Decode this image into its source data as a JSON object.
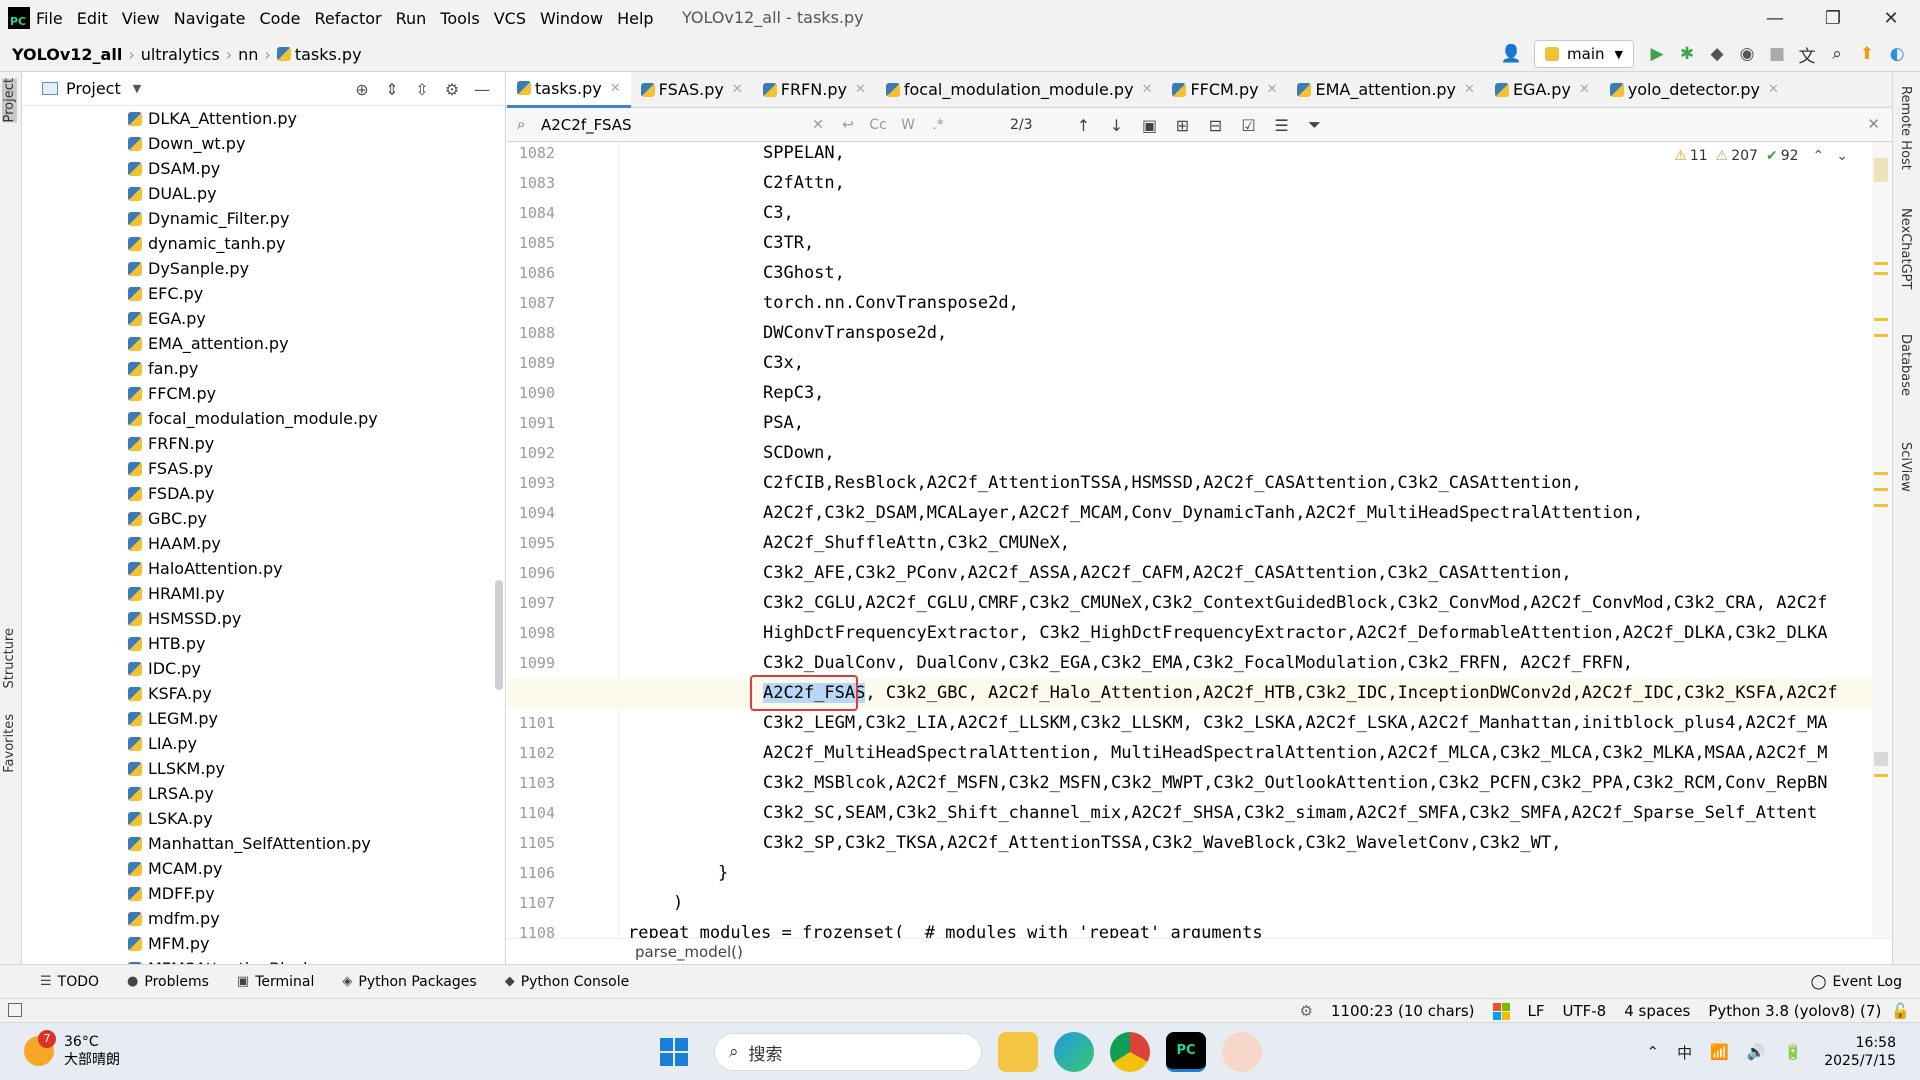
{
  "window": {
    "title": "YOLOv12_all - tasks.py",
    "menu": [
      "File",
      "Edit",
      "View",
      "Navigate",
      "Code",
      "Refactor",
      "Run",
      "Tools",
      "VCS",
      "Window",
      "Help"
    ],
    "controls": [
      "—",
      "❐",
      "✕"
    ]
  },
  "breadcrumb": [
    "YOLOv12_all",
    "ultralytics",
    "nn",
    "tasks.py"
  ],
  "nav": {
    "branch": "main"
  },
  "left_stripe": {
    "project": "Project",
    "structure": "Structure",
    "favorites": "Favorites"
  },
  "project_panel": {
    "title": "Project",
    "files": [
      "DLKA_Attention.py",
      "Down_wt.py",
      "DSAM.py",
      "DUAL.py",
      "Dynamic_Filter.py",
      "dynamic_tanh.py",
      "DySanple.py",
      "EFC.py",
      "EGA.py",
      "EMA_attention.py",
      "fan.py",
      "FFCM.py",
      "focal_modulation_module.py",
      "FRFN.py",
      "FSAS.py",
      "FSDA.py",
      "GBC.py",
      "HAAM.py",
      "HaloAttention.py",
      "HRAMI.py",
      "HSMSSD.py",
      "HTB.py",
      "IDC.py",
      "KSFA.py",
      "LEGM.py",
      "LIA.py",
      "LLSKM.py",
      "LRSA.py",
      "LSKA.py",
      "Manhattan_SelfAttention.py",
      "MCAM.py",
      "MDFF.py",
      "mdfm.py",
      "MFM.py",
      "MFMSAttentionBlock.py"
    ]
  },
  "editor_tabs": [
    {
      "label": "tasks.py",
      "active": true
    },
    {
      "label": "FSAS.py",
      "active": false
    },
    {
      "label": "FRFN.py",
      "active": false
    },
    {
      "label": "focal_modulation_module.py",
      "active": false
    },
    {
      "label": "FFCM.py",
      "active": false
    },
    {
      "label": "EMA_attention.py",
      "active": false
    },
    {
      "label": "EGA.py",
      "active": false
    },
    {
      "label": "yolo_detector.py",
      "active": false
    }
  ],
  "find": {
    "query": "A2C2f_FSAS",
    "count": "2/3",
    "opts": [
      "Cc",
      "W",
      ".*"
    ]
  },
  "inspections": {
    "warnings_a": "11",
    "warnings_b": "207",
    "ok": "92"
  },
  "code": [
    {
      "ln": "1082",
      "indent": 4,
      "text": "SPPELAN,"
    },
    {
      "ln": "1083",
      "indent": 4,
      "text": "C2fAttn,"
    },
    {
      "ln": "1084",
      "indent": 4,
      "text": "C3,"
    },
    {
      "ln": "1085",
      "indent": 4,
      "text": "C3TR,"
    },
    {
      "ln": "1086",
      "indent": 4,
      "text": "C3Ghost,"
    },
    {
      "ln": "1087",
      "indent": 4,
      "text": "torch.nn.ConvTranspose2d,"
    },
    {
      "ln": "1088",
      "indent": 4,
      "text": "DWConvTranspose2d,"
    },
    {
      "ln": "1089",
      "indent": 4,
      "text": "C3x,"
    },
    {
      "ln": "1090",
      "indent": 4,
      "text": "RepC3,"
    },
    {
      "ln": "1091",
      "indent": 4,
      "text": "PSA,"
    },
    {
      "ln": "1092",
      "indent": 4,
      "text": "SCDown,"
    },
    {
      "ln": "1093",
      "indent": 4,
      "text": "C2fCIB,ResBlock,A2C2f_AttentionTSSA,HSMSSD,A2C2f_CASAttention,C3k2_CASAttention,"
    },
    {
      "ln": "1094",
      "indent": 4,
      "text": "A2C2f,C3k2_DSAM,MCALayer,A2C2f_MCAM,Conv_DynamicTanh,A2C2f_MultiHeadSpectralAttention,"
    },
    {
      "ln": "1095",
      "indent": 4,
      "text": "A2C2f_ShuffleAttn,C3k2_CMUNeX,"
    },
    {
      "ln": "1096",
      "indent": 4,
      "text": "C3k2_AFE,C3k2_PConv,A2C2f_ASSA,A2C2f_CAFM,A2C2f_CASAttention,C3k2_CASAttention,"
    },
    {
      "ln": "1097",
      "indent": 4,
      "text": "C3k2_CGLU,A2C2f_CGLU,CMRF,C3k2_CMUNeX,C3k2_ContextGuidedBlock,C3k2_ConvMod,A2C2f_ConvMod,C3k2_CRA, A2C2f"
    },
    {
      "ln": "1098",
      "indent": 4,
      "text": "HighDctFrequencyExtractor, C3k2_HighDctFrequencyExtractor,A2C2f_DeformableAttention,A2C2f_DLKA,C3k2_DLKA"
    },
    {
      "ln": "1099",
      "indent": 4,
      "text": "C3k2_DualConv, DualConv,C3k2_EGA,C3k2_EMA,C3k2_FocalModulation,C3k2_FRFN, A2C2f_FRFN,"
    },
    {
      "ln": "1100",
      "indent": 4,
      "text": ", C3k2_GBC, A2C2f_Halo_Attention,A2C2f_HTB,C3k2_IDC,InceptionDWConv2d,A2C2f_IDC,C3k2_KSFA,A2C2f",
      "match": "A2C2f_FSAS",
      "current": true
    },
    {
      "ln": "1101",
      "indent": 4,
      "text": "C3k2_LEGM,C3k2_LIA,A2C2f_LLSKM,C3k2_LLSKM, C3k2_LSKA,A2C2f_LSKA,A2C2f_Manhattan,initblock_plus4,A2C2f_MA"
    },
    {
      "ln": "1102",
      "indent": 4,
      "text": "A2C2f_MultiHeadSpectralAttention, MultiHeadSpectralAttention,A2C2f_MLCA,C3k2_MLCA,C3k2_MLKA,MSAA,A2C2f_M"
    },
    {
      "ln": "1103",
      "indent": 4,
      "text": "C3k2_MSBlcok,A2C2f_MSFN,C3k2_MSFN,C3k2_MWPT,C3k2_OutlookAttention,C3k2_PCFN,C3k2_PPA,C3k2_RCM,Conv_RepBN"
    },
    {
      "ln": "1104",
      "indent": 4,
      "text": "C3k2_SC,SEAM,C3k2_Shift_channel_mix,A2C2f_SHSA,C3k2_simam,A2C2f_SMFA,C3k2_SMFA,A2C2f_Sparse_Self_Attent"
    },
    {
      "ln": "1105",
      "indent": 4,
      "text": "C3k2_SP,C3k2_TKSA,A2C2f_AttentionTSSA,C3k2_WaveBlock,C3k2_WaveletConv,C3k2_WT,"
    },
    {
      "ln": "1106",
      "indent": 3,
      "text": "}"
    },
    {
      "ln": "1107",
      "indent": 2,
      "text": ")"
    },
    {
      "ln": "1108",
      "indent": 1,
      "text": "repeat_modules = frozenset(  # modules with 'repeat' arguments"
    }
  ],
  "editor_breadcrumb": "parse_model()",
  "right_stripe": [
    "Remote Host",
    "NexChatGPT",
    "Database",
    "SciView"
  ],
  "tool_windows": [
    "TODO",
    "Problems",
    "Terminal",
    "Python Packages",
    "Python Console"
  ],
  "event_log": "Event Log",
  "status": {
    "position": "1100:23 (10 chars)",
    "line_sep": "LF",
    "encoding": "UTF-8",
    "indent": "4 spaces",
    "interpreter": "Python 3.8 (yolov8) (7)"
  },
  "taskbar": {
    "weather_badge": "7",
    "temp": "36°C",
    "weather": "大部晴朗",
    "search_placeholder": "搜索",
    "ime": "中",
    "time": "16:58",
    "date": "2025/7/15"
  }
}
